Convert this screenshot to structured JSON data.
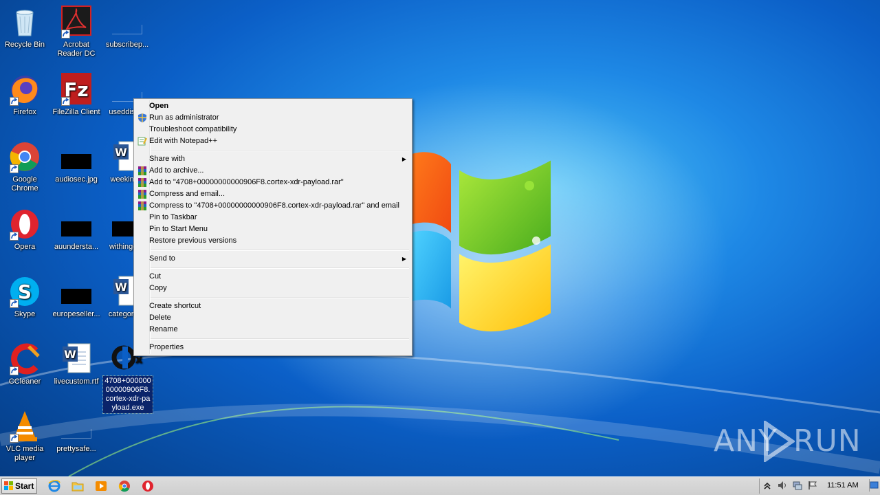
{
  "desktop": {
    "icons": [
      {
        "label": "Recycle Bin",
        "icon": "recycle-bin-icon"
      },
      {
        "label": "Acrobat Reader DC",
        "icon": "acrobat-reader-icon"
      },
      {
        "label": "subscribep...",
        "icon": "blank-file-icon"
      },
      {
        "label": "Firefox",
        "icon": "firefox-icon"
      },
      {
        "label": "FileZilla Client",
        "icon": "filezilla-icon"
      },
      {
        "label": "useddistr...",
        "icon": "blank-file-icon"
      },
      {
        "label": "Google Chrome",
        "icon": "chrome-icon"
      },
      {
        "label": "audiosec.jpg",
        "icon": "image-thumbnail-icon"
      },
      {
        "label": "weekinit...",
        "icon": "word-document-icon"
      },
      {
        "label": "Opera",
        "icon": "opera-icon"
      },
      {
        "label": "auundersta...",
        "icon": "image-thumbnail-icon"
      },
      {
        "label": "withingel...",
        "icon": "image-thumbnail-icon"
      },
      {
        "label": "Skype",
        "icon": "skype-icon"
      },
      {
        "label": "europeseller...",
        "icon": "image-thumbnail-icon"
      },
      {
        "label": "categorie...",
        "icon": "word-document-icon"
      },
      {
        "label": "CCleaner",
        "icon": "ccleaner-icon"
      },
      {
        "label": "livecustom.rtf",
        "icon": "word-document-icon"
      },
      {
        "label": "4708+00000000000906F8.cortex-xdr-payload.exe",
        "label_display": "4708+00000000000906F8.cortex-xdr-payload.exe",
        "icon": "cortex-exe-icon",
        "selected": true
      },
      {
        "label": "VLC media player",
        "icon": "vlc-icon"
      },
      {
        "label": "prettysafe...",
        "icon": "blank-file-icon"
      }
    ]
  },
  "context_menu": {
    "items": [
      {
        "label": "Open",
        "bold": true
      },
      {
        "label": "Run as administrator",
        "icon": "uac-shield-icon"
      },
      {
        "label": "Troubleshoot compatibility"
      },
      {
        "label": "Edit with Notepad++",
        "icon": "notepadpp-icon"
      },
      {
        "separator": true
      },
      {
        "label": "Share with",
        "submenu": true
      },
      {
        "label": "Add to archive...",
        "icon": "winrar-icon"
      },
      {
        "label": "Add to \"4708+00000000000906F8.cortex-xdr-payload.rar\"",
        "icon": "winrar-icon"
      },
      {
        "label": "Compress and email...",
        "icon": "winrar-icon"
      },
      {
        "label": "Compress to \"4708+00000000000906F8.cortex-xdr-payload.rar\" and email",
        "icon": "winrar-icon"
      },
      {
        "label": "Pin to Taskbar"
      },
      {
        "label": "Pin to Start Menu"
      },
      {
        "label": "Restore previous versions"
      },
      {
        "separator": true
      },
      {
        "label": "Send to",
        "submenu": true
      },
      {
        "separator": true
      },
      {
        "label": "Cut"
      },
      {
        "label": "Copy"
      },
      {
        "separator": true
      },
      {
        "label": "Create shortcut"
      },
      {
        "label": "Delete"
      },
      {
        "label": "Rename"
      },
      {
        "separator": true
      },
      {
        "label": "Properties"
      }
    ],
    "submenu_arrow": "▶"
  },
  "taskbar": {
    "start_label": "Start",
    "pinned": [
      "internet-explorer-icon",
      "file-explorer-icon",
      "media-player-icon",
      "chrome-icon",
      "opera-icon"
    ],
    "tray_icons": [
      "show-hidden-icons-chevron",
      "volume-icon",
      "network-icon",
      "action-center-flag-icon"
    ],
    "clock": "11:51 AM"
  },
  "watermark": {
    "left": "ANY",
    "right": "RUN"
  },
  "colors": {
    "menu_bg": "#f0f0f0",
    "selection": "#0a246a",
    "taskbar": "#d4d4d4"
  }
}
